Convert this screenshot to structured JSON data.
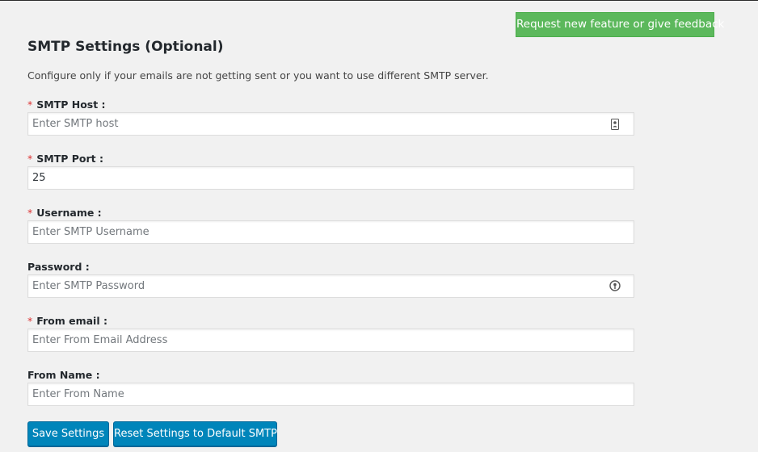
{
  "feedback_button": "Request new feature or give feedback",
  "section": {
    "title": "SMTP Settings (Optional)",
    "description": "Configure only if your emails are not getting sent or you want to use different SMTP server."
  },
  "required_marker": "*",
  "fields": {
    "smtp_host": {
      "label": "SMTP Host :",
      "value": "",
      "placeholder": "Enter SMTP host",
      "required": true
    },
    "smtp_port": {
      "label": "SMTP Port :",
      "value": "25",
      "placeholder": "",
      "required": true
    },
    "username": {
      "label": "Username :",
      "value": "",
      "placeholder": "Enter SMTP Username",
      "required": true
    },
    "password": {
      "label": "Password :",
      "value": "",
      "placeholder": "Enter SMTP Password",
      "required": false
    },
    "from_email": {
      "label": "From email :",
      "value": "",
      "placeholder": "Enter From Email Address",
      "required": true
    },
    "from_name": {
      "label": "From Name :",
      "value": "",
      "placeholder": "Enter From Name",
      "required": false
    }
  },
  "buttons": {
    "save": "Save Settings",
    "reset": "Reset Settings to Default SMTP"
  },
  "icons": {
    "host_field_icon": "contact-card-icon",
    "password_field_icon": "password-key-icon"
  },
  "colors": {
    "feedback_button": "#5cb85c",
    "primary_button": "#0085ba",
    "required_marker": "#dc3232"
  }
}
